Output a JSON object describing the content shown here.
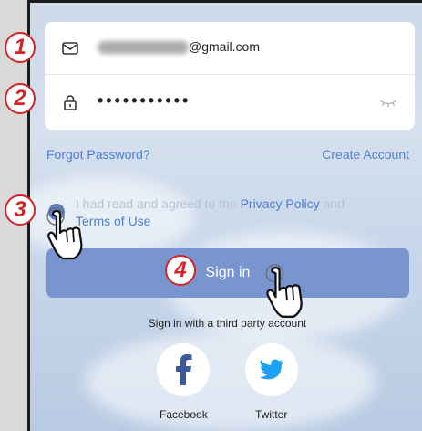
{
  "login": {
    "email_suffix": "@gmail.com",
    "password_masked": "•••••••••••",
    "forgot_password": "Forgot Password?",
    "create_account": "Create Account",
    "agree_prefix": "I had read and agreed to the",
    "privacy_policy": "Privacy Policy",
    "agree_and": "and",
    "terms_of_use": "Terms of Use",
    "sign_in": "Sign in",
    "third_party": "Sign in with a third party account"
  },
  "social": {
    "facebook_label": "Facebook",
    "twitter_label": "Twitter"
  },
  "steps": [
    "1",
    "2",
    "3",
    "4"
  ],
  "colors": {
    "accent": "#4c7fd1",
    "button": "#7895cf",
    "callout": "#d3242a",
    "facebook": "#3b5998",
    "twitter": "#1da1f2"
  },
  "icons": [
    "mail-icon",
    "lock-icon",
    "eye-closed-icon",
    "facebook-icon",
    "twitter-icon",
    "pointing-hand-icon"
  ]
}
